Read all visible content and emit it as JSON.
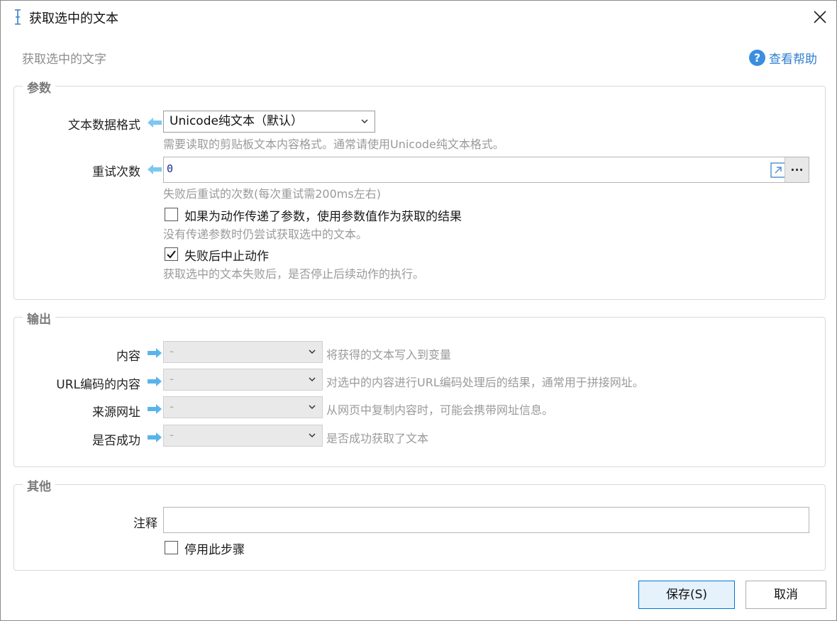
{
  "window": {
    "title": "获取选中的文本",
    "subtitle": "获取选中的文字",
    "help_label": "查看帮助"
  },
  "groups": {
    "params": {
      "title": "参数",
      "format": {
        "label": "文本数据格式",
        "value": "Unicode纯文本（默认）",
        "hint": "需要读取的剪贴板文本内容格式。通常请使用Unicode纯文本格式。"
      },
      "retry": {
        "label": "重试次数",
        "value": "0",
        "hint": "失败后重试的次数(每次重试需200ms左右)",
        "more_label": "..."
      },
      "use_param": {
        "label": "如果为动作传递了参数，使用参数值作为获取的结果",
        "checked": false,
        "hint": "没有传递参数时仍尝试获取选中的文本。"
      },
      "abort_on_fail": {
        "label": "失败后中止动作",
        "checked": true,
        "hint": "获取选中的文本失败后，是否停止后续动作的执行。"
      }
    },
    "output": {
      "title": "输出",
      "rows": [
        {
          "label": "内容",
          "value": "-",
          "hint": "将获得的文本写入到变量"
        },
        {
          "label": "URL编码的内容",
          "value": "-",
          "hint": "对选中的内容进行URL编码处理后的结果，通常用于拼接网址。"
        },
        {
          "label": "来源网址",
          "value": "-",
          "hint": "从网页中复制内容时，可能会携带网址信息。"
        },
        {
          "label": "是否成功",
          "value": "-",
          "hint": "是否成功获取了文本"
        }
      ]
    },
    "other": {
      "title": "其他",
      "comment": {
        "label": "注释",
        "value": ""
      },
      "disable_step": {
        "label": "停用此步骤",
        "checked": false
      }
    }
  },
  "buttons": {
    "save": "保存(S)",
    "cancel": "取消"
  },
  "colors": {
    "accent": "#0078d7",
    "arrow_in": "#7cc8f0",
    "arrow_out": "#5ab4ea",
    "help": "#3a8ee0"
  },
  "icons": {
    "title": "text-cursor-icon",
    "close": "close-icon",
    "help": "question-circle-icon",
    "arrow_in": "arrow-left-icon",
    "arrow_out": "arrow-right-icon",
    "external": "open-external-icon",
    "dropdown": "chevron-down-icon",
    "check": "checkmark-icon"
  }
}
